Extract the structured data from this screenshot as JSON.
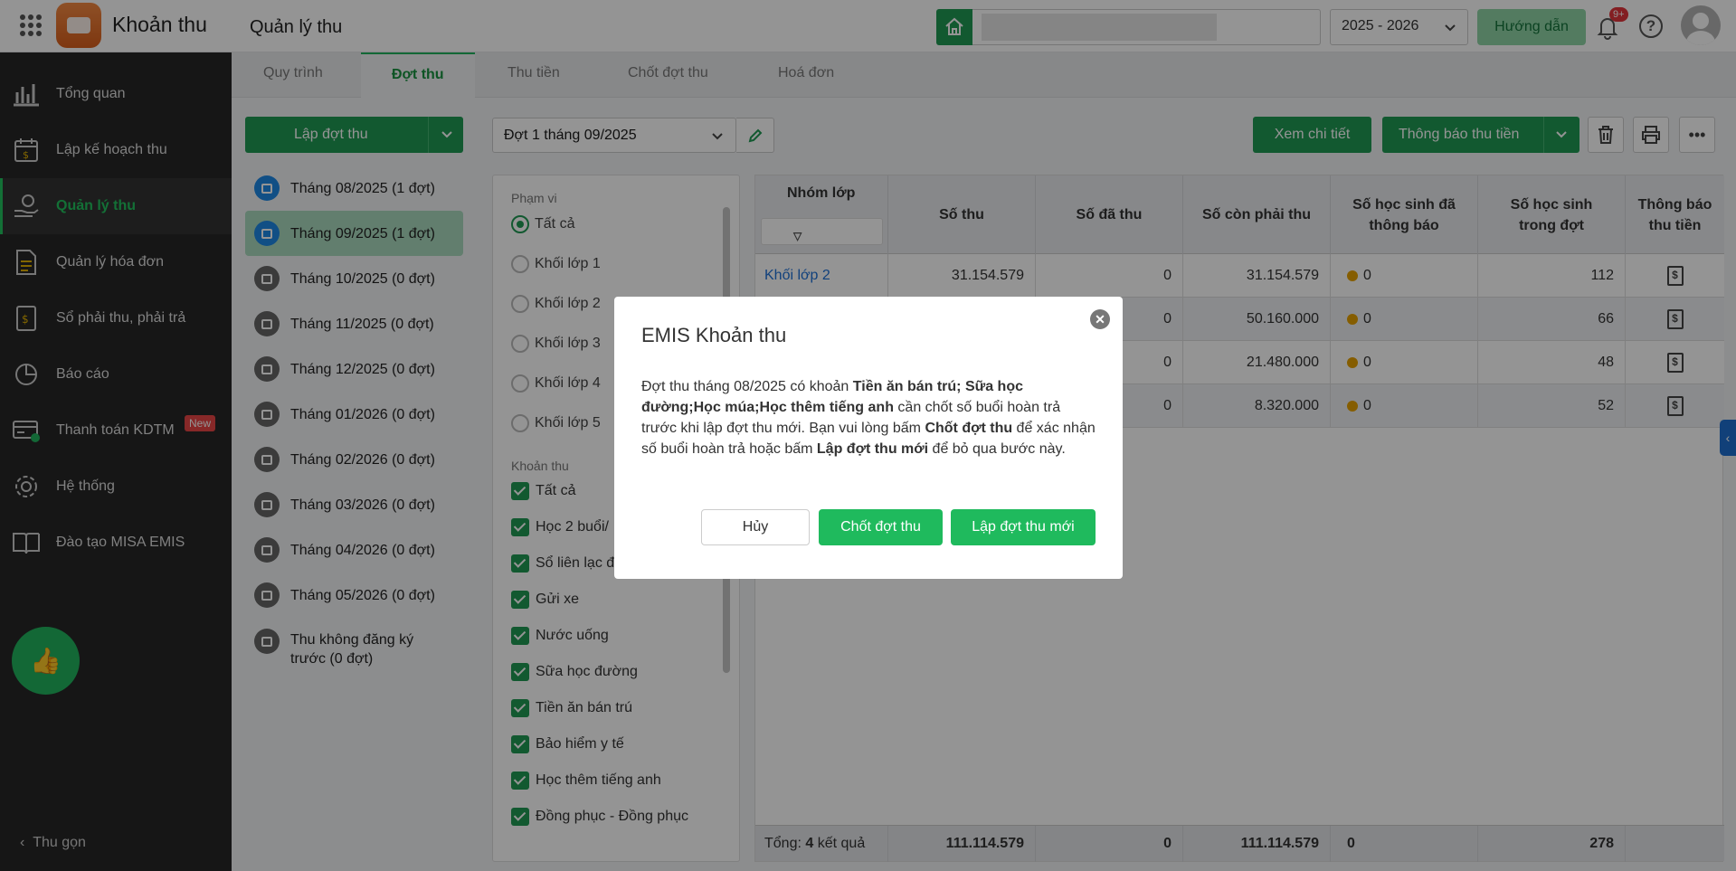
{
  "app": {
    "name": "Khoản thu",
    "page_title": "Quản lý thu",
    "school_year": "2025 - 2026",
    "guide_label": "Hướng dẫn",
    "notification_badge": "9+"
  },
  "sidebar": {
    "items": [
      {
        "label": "Tổng quan",
        "icon": "chart-bars-icon"
      },
      {
        "label": "Lập kế hoạch thu",
        "icon": "calendar-money-icon"
      },
      {
        "label": "Quản lý thu",
        "icon": "hand-coin-icon",
        "active": true
      },
      {
        "label": "Quản lý hóa đơn",
        "icon": "invoice-icon"
      },
      {
        "label": "Sổ phải thu, phải trả",
        "icon": "ledger-icon"
      },
      {
        "label": "Báo cáo",
        "icon": "pie-chart-icon"
      },
      {
        "label": "Thanh toán KDTM",
        "icon": "payment-card-icon",
        "tag": "New"
      },
      {
        "label": "Hệ thống",
        "icon": "gear-icon"
      },
      {
        "label": "Đào tạo MISA EMIS",
        "icon": "book-icon"
      }
    ],
    "collapse_label": "Thu gọn"
  },
  "tabs": [
    "Quy trình",
    "Đợt thu",
    "Thu tiền",
    "Chốt đợt thu",
    "Hoá đơn"
  ],
  "left_panel": {
    "create_label": "Lập đợt thu",
    "months": [
      "Tháng 08/2025 (1 đợt)",
      "Tháng 09/2025 (1 đợt)",
      "Tháng 10/2025 (0 đợt)",
      "Tháng 11/2025 (0 đợt)",
      "Tháng 12/2025 (0 đợt)",
      "Tháng 01/2026 (0 đợt)",
      "Tháng 02/2026 (0 đợt)",
      "Tháng 03/2026 (0 đợt)",
      "Tháng 04/2026 (0 đợt)",
      "Tháng 05/2026 (0 đợt)",
      "Thu không đăng ký trước (0 đợt)"
    ]
  },
  "filter": {
    "batch_value": "Đợt 1 tháng 09/2025",
    "scope_title": "Phạm vi",
    "scope_options": [
      "Tất cả",
      "Khối lớp 1",
      "Khối lớp 2",
      "Khối lớp 3",
      "Khối lớp 4",
      "Khối lớp 5"
    ],
    "fees_title": "Khoản thu",
    "fees": [
      "Tất cả",
      "Học 2 buổi/",
      "Sổ liên lạc đ",
      "Gửi xe",
      "Nước uống",
      "Sữa học đường",
      "Tiền ăn bán trú",
      "Bảo hiểm y tế",
      "Học thêm tiếng anh",
      "Đồng phục - Đồng phục"
    ]
  },
  "toolbar": {
    "view_detail": "Xem chi tiết",
    "notify": "Thông báo thu tiền"
  },
  "table": {
    "headers": [
      "Nhóm lớp",
      "Số thu",
      "Số đã thu",
      "Số còn phải thu",
      "Số học sinh đã thông báo",
      "Số học sinh trong đợt",
      "Thông báo thu tiền"
    ],
    "rows": [
      {
        "group": "Khối lớp 2",
        "amount": "31.154.579",
        "paid": "0",
        "remaining": "31.154.579",
        "notified": "0",
        "students": "112"
      },
      {
        "group": "",
        "amount": "",
        "paid": "0",
        "remaining": "50.160.000",
        "notified": "0",
        "students": "66"
      },
      {
        "group": "",
        "amount": "",
        "paid": "0",
        "remaining": "21.480.000",
        "notified": "0",
        "students": "48"
      },
      {
        "group": "",
        "amount": "",
        "paid": "0",
        "remaining": "8.320.000",
        "notified": "0",
        "students": "52"
      }
    ],
    "footer": {
      "label_prefix": "Tổng: ",
      "count": "4",
      "label_suffix": " kết quả",
      "amount": "111.114.579",
      "paid": "0",
      "remaining": "111.114.579",
      "notified": "0",
      "students": "278"
    }
  },
  "modal": {
    "title": "EMIS Khoản thu",
    "msg_1": "Đợt thu tháng 08/2025 có khoản ",
    "msg_bold_1": "Tiền ăn bán trú; Sữa học đường;Học múa;Học thêm tiếng anh",
    "msg_2": " cần chốt số buổi hoàn trả trước khi lập đợt thu mới. Bạn vui lòng bấm ",
    "msg_bold_2": "Chốt đợt thu",
    "msg_3": " để xác nhận số buổi hoàn trả hoặc bấm ",
    "msg_bold_3": "Lập đợt thu mới",
    "msg_4": " để bỏ qua bước này.",
    "cancel": "Hủy",
    "close_batch": "Chốt đợt thu",
    "new_batch": "Lập đợt thu mới"
  }
}
